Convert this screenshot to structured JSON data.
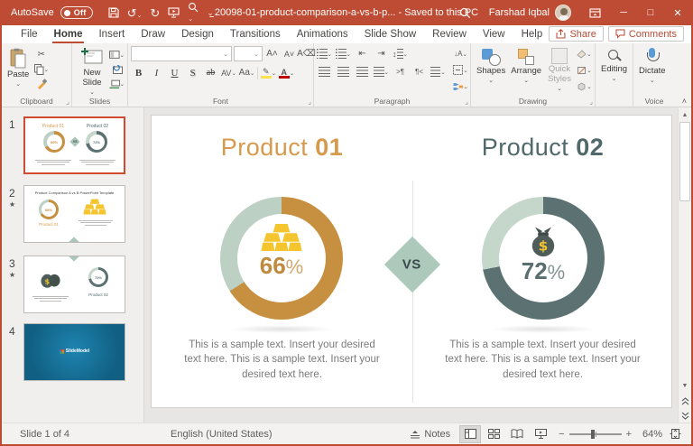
{
  "titlebar": {
    "autosave": "AutoSave",
    "autosave_state": "Off",
    "title": "20098-01-product-comparison-a-vs-b-p...",
    "saved": "- Saved to this PC",
    "user": "Farshad Iqbal"
  },
  "tabs": {
    "file": "File",
    "home": "Home",
    "insert": "Insert",
    "draw": "Draw",
    "design": "Design",
    "transitions": "Transitions",
    "animations": "Animations",
    "slideshow": "Slide Show",
    "review": "Review",
    "view": "View",
    "help": "Help"
  },
  "actions": {
    "share": "Share",
    "comments": "Comments"
  },
  "ribbon": {
    "clipboard_label": "Clipboard",
    "paste": "Paste",
    "slides_label": "Slides",
    "new_slide": "New Slide",
    "font_label": "Font",
    "bold": "B",
    "italic": "I",
    "underline": "U",
    "shadow": "S",
    "strike": "ab",
    "spacing": "AV",
    "case": "Aa",
    "paragraph_label": "Paragraph",
    "drawing_label": "Drawing",
    "shapes": "Shapes",
    "arrange": "Arrange",
    "quick_styles": "Quick Styles",
    "editing": "Editing",
    "dictate": "Dictate",
    "voice_label": "Voice"
  },
  "thumbnails": {
    "t1": {
      "num": "1",
      "p1": "Product 01",
      "p2": "Product 02",
      "v1": "66%",
      "v2": "72%",
      "vs": "VS"
    },
    "t2": {
      "num": "2",
      "star": "★",
      "title": "Product Comparison A vs B PowerPoint Template",
      "product": "Product 01",
      "pct": "66%"
    },
    "t3": {
      "num": "3",
      "star": "★",
      "product": "Product 02",
      "pct": "72%"
    },
    "t4": {
      "num": "4",
      "brand": "SlideModel"
    }
  },
  "slide": {
    "left": {
      "title": "Product",
      "num": "01",
      "value": "66",
      "suffix": "%",
      "body": "This is a sample text. Insert your desired text here. This is a sample text. Insert your desired text here."
    },
    "right": {
      "title": "Product",
      "num": "02",
      "value": "72",
      "suffix": "%",
      "body": "This is a sample text. Insert your desired text here. This is a sample text. Insert your desired text here."
    },
    "vs": "VS"
  },
  "statusbar": {
    "slide": "Slide 1 of 4",
    "language": "English (United States)",
    "notes": "Notes",
    "zoom": "64%"
  },
  "colors": {
    "accent": "#BE4B33",
    "product1": "#D79A4C",
    "product2": "#50696B",
    "donut1": "#C69040",
    "donut1_rest": "#BCD0C3",
    "donut2": "#5C7172",
    "donut2_rest": "#C5D6CA",
    "gold": "#F5C52F",
    "diamond": "#ADC9BC"
  }
}
